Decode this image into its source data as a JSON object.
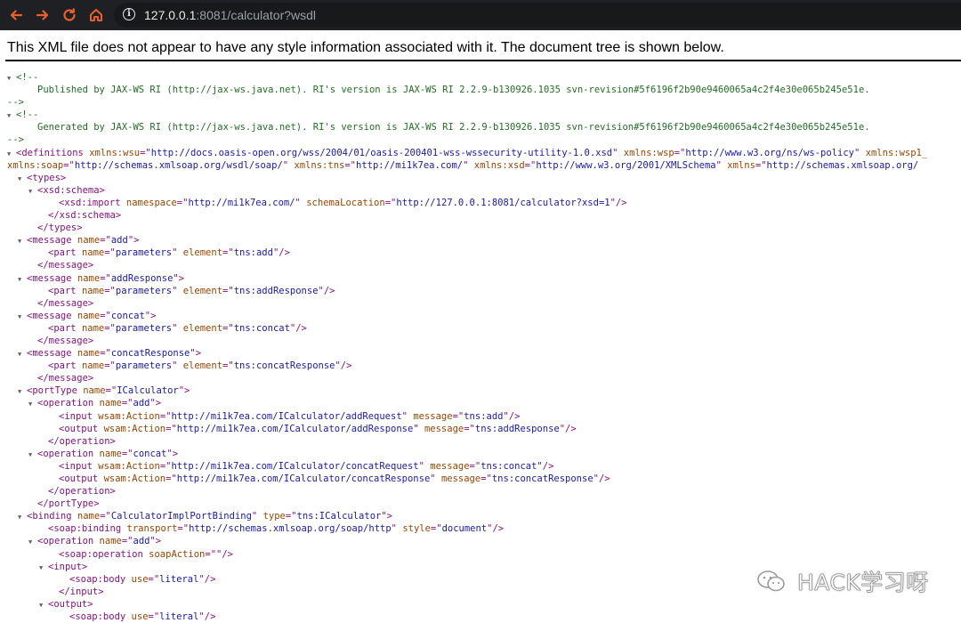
{
  "browser": {
    "url_host": "127.0.0.1",
    "url_rest": ":8081/calculator?wsdl",
    "icons": [
      "back-icon",
      "forward-icon",
      "reload-icon",
      "home-icon",
      "info-icon"
    ],
    "colors": {
      "toolbar": "#1f2023",
      "back": "#e8612c",
      "forward": "#e8612c",
      "reload": "#e8612c",
      "home": "#e8612c"
    }
  },
  "notice": "This XML file does not appear to have any style information associated with it. The document tree is shown below.",
  "watermark": {
    "text": "HACK学习呀",
    "icon": "wechat-icon"
  },
  "xml_lines": [
    {
      "ind": 0,
      "tog": "▼",
      "tokens": [
        [
          "ct",
          "<!--"
        ]
      ]
    },
    {
      "ind": 2,
      "tog": "",
      "tokens": [
        [
          "ct",
          "Published by JAX-WS RI (http://jax-ws.java.net). RI's version is JAX-WS RI 2.2.9-b130926.1035 svn-revision#5f6196f2b90e9460065a4c2f4e30e065b245e51e."
        ]
      ]
    },
    {
      "ind": 0,
      "tog": "",
      "tokens": [
        [
          "ct",
          "-->"
        ]
      ]
    },
    {
      "ind": 0,
      "tog": "▼",
      "tokens": [
        [
          "ct",
          "<!--"
        ]
      ]
    },
    {
      "ind": 2,
      "tog": "",
      "tokens": [
        [
          "ct",
          "Generated by JAX-WS RI (http://jax-ws.java.net). RI's version is JAX-WS RI 2.2.9-b130926.1035 svn-revision#5f6196f2b90e9460065a4c2f4e30e065b245e51e."
        ]
      ]
    },
    {
      "ind": 0,
      "tog": "",
      "tokens": [
        [
          "ct",
          "-->"
        ]
      ]
    },
    {
      "ind": 0,
      "tog": "▼",
      "tokens": [
        [
          "tag",
          "<definitions"
        ],
        [
          "t",
          " "
        ],
        [
          "an",
          "xmlns:wsu"
        ],
        [
          "p",
          "=\""
        ],
        [
          "av",
          "http://docs.oasis-open.org/wss/2004/01/oasis-200401-wss-wssecurity-utility-1.0.xsd"
        ],
        [
          "p",
          "\""
        ],
        [
          "t",
          " "
        ],
        [
          "an",
          "xmlns:wsp"
        ],
        [
          "p",
          "=\""
        ],
        [
          "av",
          "http://www.w3.org/ns/ws-policy"
        ],
        [
          "p",
          "\""
        ],
        [
          "t",
          " "
        ],
        [
          "an",
          "xmlns:wsp1_"
        ]
      ]
    },
    {
      "ind": 0,
      "tog": "",
      "tokens": [
        [
          "an",
          "xmlns:soap"
        ],
        [
          "p",
          "=\""
        ],
        [
          "av",
          "http://schemas.xmlsoap.org/wsdl/soap/"
        ],
        [
          "p",
          "\""
        ],
        [
          "t",
          " "
        ],
        [
          "an",
          "xmlns:tns"
        ],
        [
          "p",
          "=\""
        ],
        [
          "av",
          "http://mi1k7ea.com/"
        ],
        [
          "p",
          "\""
        ],
        [
          "t",
          " "
        ],
        [
          "an",
          "xmlns:xsd"
        ],
        [
          "p",
          "=\""
        ],
        [
          "av",
          "http://www.w3.org/2001/XMLSchema"
        ],
        [
          "p",
          "\""
        ],
        [
          "t",
          " "
        ],
        [
          "an",
          "xmlns"
        ],
        [
          "p",
          "=\""
        ],
        [
          "av",
          "http://schemas.xmlsoap.org/"
        ]
      ]
    },
    {
      "ind": 1,
      "tog": "▼",
      "tokens": [
        [
          "tag",
          "<types>"
        ]
      ]
    },
    {
      "ind": 2,
      "tog": "▼",
      "tokens": [
        [
          "tag",
          "<xsd:schema>"
        ]
      ]
    },
    {
      "ind": 4,
      "tog": "",
      "tokens": [
        [
          "tag",
          "<xsd:import"
        ],
        [
          "t",
          " "
        ],
        [
          "an",
          "namespace"
        ],
        [
          "p",
          "=\""
        ],
        [
          "av",
          "http://mi1k7ea.com/"
        ],
        [
          "p",
          "\""
        ],
        [
          "t",
          " "
        ],
        [
          "an",
          "schemaLocation"
        ],
        [
          "p",
          "=\""
        ],
        [
          "av",
          "http://127.0.0.1:8081/calculator?xsd=1"
        ],
        [
          "p",
          "\"/>"
        ]
      ]
    },
    {
      "ind": 3,
      "tog": "",
      "tokens": [
        [
          "tag",
          "</xsd:schema>"
        ]
      ]
    },
    {
      "ind": 2,
      "tog": "",
      "tokens": [
        [
          "tag",
          "</types>"
        ]
      ]
    },
    {
      "ind": 1,
      "tog": "▼",
      "tokens": [
        [
          "tag",
          "<message"
        ],
        [
          "t",
          " "
        ],
        [
          "an",
          "name"
        ],
        [
          "p",
          "=\""
        ],
        [
          "av",
          "add"
        ],
        [
          "p",
          "\">"
        ]
      ]
    },
    {
      "ind": 3,
      "tog": "",
      "tokens": [
        [
          "tag",
          "<part"
        ],
        [
          "t",
          " "
        ],
        [
          "an",
          "name"
        ],
        [
          "p",
          "=\""
        ],
        [
          "av",
          "parameters"
        ],
        [
          "p",
          "\""
        ],
        [
          "t",
          " "
        ],
        [
          "an",
          "element"
        ],
        [
          "p",
          "=\""
        ],
        [
          "av",
          "tns:add"
        ],
        [
          "p",
          "\"/>"
        ]
      ]
    },
    {
      "ind": 2,
      "tog": "",
      "tokens": [
        [
          "tag",
          "</message>"
        ]
      ]
    },
    {
      "ind": 1,
      "tog": "▼",
      "tokens": [
        [
          "tag",
          "<message"
        ],
        [
          "t",
          " "
        ],
        [
          "an",
          "name"
        ],
        [
          "p",
          "=\""
        ],
        [
          "av",
          "addResponse"
        ],
        [
          "p",
          "\">"
        ]
      ]
    },
    {
      "ind": 3,
      "tog": "",
      "tokens": [
        [
          "tag",
          "<part"
        ],
        [
          "t",
          " "
        ],
        [
          "an",
          "name"
        ],
        [
          "p",
          "=\""
        ],
        [
          "av",
          "parameters"
        ],
        [
          "p",
          "\""
        ],
        [
          "t",
          " "
        ],
        [
          "an",
          "element"
        ],
        [
          "p",
          "=\""
        ],
        [
          "av",
          "tns:addResponse"
        ],
        [
          "p",
          "\"/>"
        ]
      ]
    },
    {
      "ind": 2,
      "tog": "",
      "tokens": [
        [
          "tag",
          "</message>"
        ]
      ]
    },
    {
      "ind": 1,
      "tog": "▼",
      "tokens": [
        [
          "tag",
          "<message"
        ],
        [
          "t",
          " "
        ],
        [
          "an",
          "name"
        ],
        [
          "p",
          "=\""
        ],
        [
          "av",
          "concat"
        ],
        [
          "p",
          "\">"
        ]
      ]
    },
    {
      "ind": 3,
      "tog": "",
      "tokens": [
        [
          "tag",
          "<part"
        ],
        [
          "t",
          " "
        ],
        [
          "an",
          "name"
        ],
        [
          "p",
          "=\""
        ],
        [
          "av",
          "parameters"
        ],
        [
          "p",
          "\""
        ],
        [
          "t",
          " "
        ],
        [
          "an",
          "element"
        ],
        [
          "p",
          "=\""
        ],
        [
          "av",
          "tns:concat"
        ],
        [
          "p",
          "\"/>"
        ]
      ]
    },
    {
      "ind": 2,
      "tog": "",
      "tokens": [
        [
          "tag",
          "</message>"
        ]
      ]
    },
    {
      "ind": 1,
      "tog": "▼",
      "tokens": [
        [
          "tag",
          "<message"
        ],
        [
          "t",
          " "
        ],
        [
          "an",
          "name"
        ],
        [
          "p",
          "=\""
        ],
        [
          "av",
          "concatResponse"
        ],
        [
          "p",
          "\">"
        ]
      ]
    },
    {
      "ind": 3,
      "tog": "",
      "tokens": [
        [
          "tag",
          "<part"
        ],
        [
          "t",
          " "
        ],
        [
          "an",
          "name"
        ],
        [
          "p",
          "=\""
        ],
        [
          "av",
          "parameters"
        ],
        [
          "p",
          "\""
        ],
        [
          "t",
          " "
        ],
        [
          "an",
          "element"
        ],
        [
          "p",
          "=\""
        ],
        [
          "av",
          "tns:concatResponse"
        ],
        [
          "p",
          "\"/>"
        ]
      ]
    },
    {
      "ind": 2,
      "tog": "",
      "tokens": [
        [
          "tag",
          "</message>"
        ]
      ]
    },
    {
      "ind": 1,
      "tog": "▼",
      "tokens": [
        [
          "tag",
          "<portType"
        ],
        [
          "t",
          " "
        ],
        [
          "an",
          "name"
        ],
        [
          "p",
          "=\""
        ],
        [
          "av",
          "ICalculator"
        ],
        [
          "p",
          "\">"
        ]
      ]
    },
    {
      "ind": 2,
      "tog": "▼",
      "tokens": [
        [
          "tag",
          "<operation"
        ],
        [
          "t",
          " "
        ],
        [
          "an",
          "name"
        ],
        [
          "p",
          "=\""
        ],
        [
          "av",
          "add"
        ],
        [
          "p",
          "\">"
        ]
      ]
    },
    {
      "ind": 4,
      "tog": "",
      "tokens": [
        [
          "tag",
          "<input"
        ],
        [
          "t",
          " "
        ],
        [
          "an",
          "wsam:Action"
        ],
        [
          "p",
          "=\""
        ],
        [
          "av",
          "http://mi1k7ea.com/ICalculator/addRequest"
        ],
        [
          "p",
          "\""
        ],
        [
          "t",
          " "
        ],
        [
          "an",
          "message"
        ],
        [
          "p",
          "=\""
        ],
        [
          "av",
          "tns:add"
        ],
        [
          "p",
          "\"/>"
        ]
      ]
    },
    {
      "ind": 4,
      "tog": "",
      "tokens": [
        [
          "tag",
          "<output"
        ],
        [
          "t",
          " "
        ],
        [
          "an",
          "wsam:Action"
        ],
        [
          "p",
          "=\""
        ],
        [
          "av",
          "http://mi1k7ea.com/ICalculator/addResponse"
        ],
        [
          "p",
          "\""
        ],
        [
          "t",
          " "
        ],
        [
          "an",
          "message"
        ],
        [
          "p",
          "=\""
        ],
        [
          "av",
          "tns:addResponse"
        ],
        [
          "p",
          "\"/>"
        ]
      ]
    },
    {
      "ind": 3,
      "tog": "",
      "tokens": [
        [
          "tag",
          "</operation>"
        ]
      ]
    },
    {
      "ind": 2,
      "tog": "▼",
      "tokens": [
        [
          "tag",
          "<operation"
        ],
        [
          "t",
          " "
        ],
        [
          "an",
          "name"
        ],
        [
          "p",
          "=\""
        ],
        [
          "av",
          "concat"
        ],
        [
          "p",
          "\">"
        ]
      ]
    },
    {
      "ind": 4,
      "tog": "",
      "tokens": [
        [
          "tag",
          "<input"
        ],
        [
          "t",
          " "
        ],
        [
          "an",
          "wsam:Action"
        ],
        [
          "p",
          "=\""
        ],
        [
          "av",
          "http://mi1k7ea.com/ICalculator/concatRequest"
        ],
        [
          "p",
          "\""
        ],
        [
          "t",
          " "
        ],
        [
          "an",
          "message"
        ],
        [
          "p",
          "=\""
        ],
        [
          "av",
          "tns:concat"
        ],
        [
          "p",
          "\"/>"
        ]
      ]
    },
    {
      "ind": 4,
      "tog": "",
      "tokens": [
        [
          "tag",
          "<output"
        ],
        [
          "t",
          " "
        ],
        [
          "an",
          "wsam:Action"
        ],
        [
          "p",
          "=\""
        ],
        [
          "av",
          "http://mi1k7ea.com/ICalculator/concatResponse"
        ],
        [
          "p",
          "\""
        ],
        [
          "t",
          " "
        ],
        [
          "an",
          "message"
        ],
        [
          "p",
          "=\""
        ],
        [
          "av",
          "tns:concatResponse"
        ],
        [
          "p",
          "\"/>"
        ]
      ]
    },
    {
      "ind": 3,
      "tog": "",
      "tokens": [
        [
          "tag",
          "</operation>"
        ]
      ]
    },
    {
      "ind": 2,
      "tog": "",
      "tokens": [
        [
          "tag",
          "</portType>"
        ]
      ]
    },
    {
      "ind": 1,
      "tog": "▼",
      "tokens": [
        [
          "tag",
          "<binding"
        ],
        [
          "t",
          " "
        ],
        [
          "an",
          "name"
        ],
        [
          "p",
          "=\""
        ],
        [
          "av",
          "CalculatorImplPortBinding"
        ],
        [
          "p",
          "\""
        ],
        [
          "t",
          " "
        ],
        [
          "an",
          "type"
        ],
        [
          "p",
          "=\""
        ],
        [
          "av",
          "tns:ICalculator"
        ],
        [
          "p",
          "\">"
        ]
      ]
    },
    {
      "ind": 3,
      "tog": "",
      "tokens": [
        [
          "tag",
          "<soap:binding"
        ],
        [
          "t",
          " "
        ],
        [
          "an",
          "transport"
        ],
        [
          "p",
          "=\""
        ],
        [
          "av",
          "http://schemas.xmlsoap.org/soap/http"
        ],
        [
          "p",
          "\""
        ],
        [
          "t",
          " "
        ],
        [
          "an",
          "style"
        ],
        [
          "p",
          "=\""
        ],
        [
          "av",
          "document"
        ],
        [
          "p",
          "\"/>"
        ]
      ]
    },
    {
      "ind": 2,
      "tog": "▼",
      "tokens": [
        [
          "tag",
          "<operation"
        ],
        [
          "t",
          " "
        ],
        [
          "an",
          "name"
        ],
        [
          "p",
          "=\""
        ],
        [
          "av",
          "add"
        ],
        [
          "p",
          "\">"
        ]
      ]
    },
    {
      "ind": 4,
      "tog": "",
      "tokens": [
        [
          "tag",
          "<soap:operation"
        ],
        [
          "t",
          " "
        ],
        [
          "an",
          "soapAction"
        ],
        [
          "p",
          "=\""
        ],
        [
          "av",
          ""
        ],
        [
          "p",
          "\"/>"
        ]
      ]
    },
    {
      "ind": 3,
      "tog": "▼",
      "tokens": [
        [
          "tag",
          "<input>"
        ]
      ]
    },
    {
      "ind": 5,
      "tog": "",
      "tokens": [
        [
          "tag",
          "<soap:body"
        ],
        [
          "t",
          " "
        ],
        [
          "an",
          "use"
        ],
        [
          "p",
          "=\""
        ],
        [
          "av",
          "literal"
        ],
        [
          "p",
          "\"/>"
        ]
      ]
    },
    {
      "ind": 4,
      "tog": "",
      "tokens": [
        [
          "tag",
          "</input>"
        ]
      ]
    },
    {
      "ind": 3,
      "tog": "▼",
      "tokens": [
        [
          "tag",
          "<output>"
        ]
      ]
    },
    {
      "ind": 5,
      "tog": "",
      "tokens": [
        [
          "tag",
          "<soap:body"
        ],
        [
          "t",
          " "
        ],
        [
          "an",
          "use"
        ],
        [
          "p",
          "=\""
        ],
        [
          "av",
          "literal"
        ],
        [
          "p",
          "\"/>"
        ]
      ]
    }
  ]
}
